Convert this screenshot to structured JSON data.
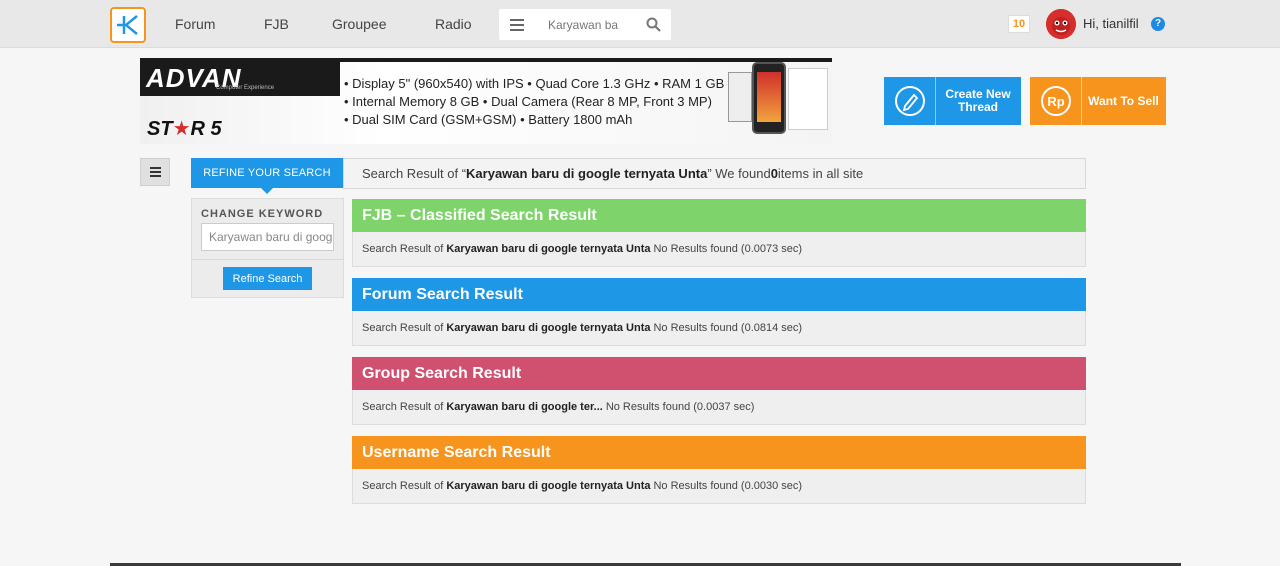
{
  "nav": {
    "links": [
      "Forum",
      "FJB",
      "Groupee",
      "Radio"
    ],
    "search_value": "Karyawan ba",
    "notification_count": "10",
    "greeting": "Hi, tianilfil",
    "help": "?"
  },
  "banner": {
    "brand": "ADVAN",
    "brand_sub": "Computer Experience",
    "model_prefix": "ST",
    "model_star": "★",
    "model_suffix": "R 5",
    "specs": [
      "• Display 5\" (960x540) with IPS  • Quad Core 1.3 GHz • RAM 1 GB",
      "• Internal Memory 8 GB  • Dual Camera (Rear 8 MP, Front 3 MP)",
      "• Dual SIM Card (GSM+GSM)  • Battery 1800 mAh"
    ]
  },
  "actions": {
    "create_thread": "Create New Thread",
    "want_to_sell": "Want To Sell"
  },
  "refine": {
    "tab_label": "REFINE YOUR SEARCH",
    "change_keyword_label": "CHANGE KEYWORD",
    "keyword_value": "Karyawan baru di google ternyata Unta",
    "button_label": "Refine Search"
  },
  "summary": {
    "prefix": "Search Result of “",
    "keyword": "Karyawan baru di google ternyata Unta",
    "middle": "” We found ",
    "count": "0",
    "suffix": " items in all site"
  },
  "results": [
    {
      "title": "FJB – Classified Search Result",
      "color": "#7ed36a",
      "prefix": "Search Result of",
      "keyword": "Karyawan baru di google ternyata Unta",
      "status": " No Results found (0.0073 sec)"
    },
    {
      "title": "Forum Search Result",
      "color": "#1e97e6",
      "prefix": "Search Result of",
      "keyword": "Karyawan baru di google ternyata Unta",
      "status": "No Results found (0.0814 sec)"
    },
    {
      "title": "Group Search Result",
      "color": "#d0516f",
      "prefix": "Search Result of",
      "keyword": "Karyawan baru di google ter...",
      "status": "No Results found (0.0037 sec)"
    },
    {
      "title": "Username Search Result",
      "color": "#f7941d",
      "prefix": "Search Result of",
      "keyword": "Karyawan baru di google ternyata Unta",
      "status": "No Results found (0.0030 sec)"
    }
  ]
}
